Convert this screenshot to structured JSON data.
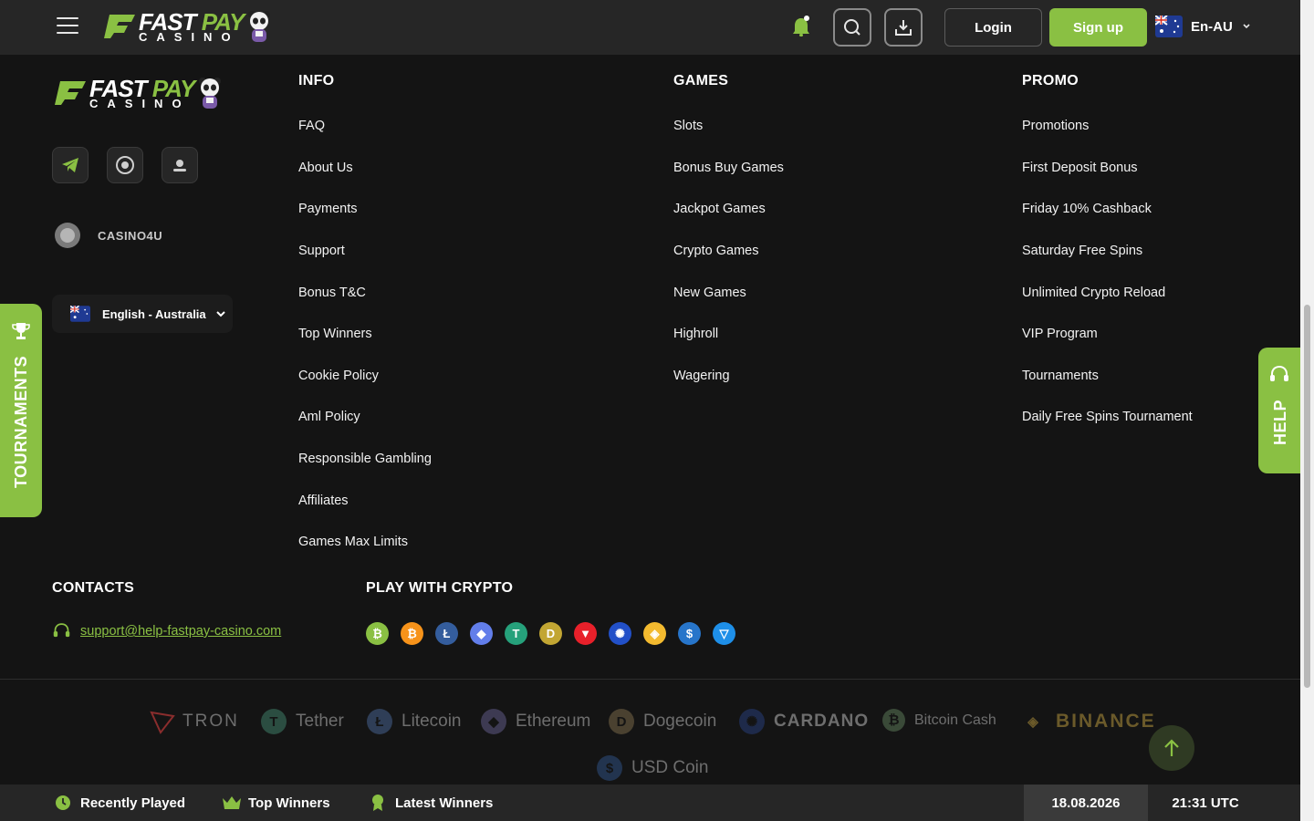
{
  "header": {
    "logo": {
      "fast": "FAST",
      "pay": "PAY",
      "casino": "CASINO"
    },
    "login_label": "Login",
    "signup_label": "Sign up",
    "language_code": "En-AU"
  },
  "footer_logo": {
    "fast": "FAST",
    "pay": "PAY",
    "casino": "CASINO"
  },
  "partner": {
    "label": "CASINO4U"
  },
  "language_select": {
    "label": "English - Australia"
  },
  "tabs": {
    "tournaments": "TOURNAMENTS",
    "help": "HELP"
  },
  "columns": {
    "info": {
      "title": "INFO",
      "links": [
        "FAQ",
        "About Us",
        "Payments",
        "Support",
        "Bonus T&C",
        "Top Winners",
        "Cookie Policy",
        "Aml Policy",
        "Responsible Gambling",
        "Affiliates",
        "Games Max Limits"
      ]
    },
    "games": {
      "title": "GAMES",
      "links": [
        "Slots",
        "Bonus Buy Games",
        "Jackpot Games",
        "Crypto Games",
        "New Games",
        "Highroll",
        "Wagering"
      ]
    },
    "promo": {
      "title": "PROMO",
      "links": [
        "Promotions",
        "First Deposit Bonus",
        "Friday 10% Cashback",
        "Saturday Free Spins",
        "Unlimited Crypto Reload",
        "VIP Program",
        "Tournaments",
        "Daily Free Spins Tournament"
      ]
    }
  },
  "contacts": {
    "title": "CONTACTS",
    "email": "support@help-fastpay-casino.com"
  },
  "crypto": {
    "title": "PLAY WITH CRYPTO",
    "coins": [
      {
        "name": "bitcoin-cash",
        "glyph": "₿",
        "color": "#8ac043"
      },
      {
        "name": "bitcoin",
        "glyph": "₿",
        "color": "#f7931a"
      },
      {
        "name": "litecoin",
        "glyph": "Ł",
        "color": "#345d9d"
      },
      {
        "name": "ethereum",
        "glyph": "◆",
        "color": "#627eea"
      },
      {
        "name": "tether",
        "glyph": "T",
        "color": "#26a17b"
      },
      {
        "name": "dogecoin",
        "glyph": "D",
        "color": "#c2a633"
      },
      {
        "name": "tron",
        "glyph": "▼",
        "color": "#e8202a"
      },
      {
        "name": "cardano",
        "glyph": "✺",
        "color": "#2250c8"
      },
      {
        "name": "binance",
        "glyph": "◈",
        "color": "#f3ba2f"
      },
      {
        "name": "usd-coin",
        "glyph": "$",
        "color": "#2775ca"
      },
      {
        "name": "toncoin",
        "glyph": "▽",
        "color": "#1e8fe8"
      }
    ]
  },
  "brands": [
    "TRON",
    "Tether",
    "Litecoin",
    "Ethereum",
    "Dogecoin",
    "CARDANO",
    "Bitcoin Cash",
    "BINANCE",
    "USD Coin"
  ],
  "bottom_bar": {
    "recently_played": "Recently Played",
    "top_winners": "Top Winners",
    "latest_winners": "Latest Winners",
    "date": "18.08.2026",
    "time": "21:31 UTC"
  },
  "colors": {
    "accent": "#8ac043",
    "background": "#141414",
    "header": "#262626"
  }
}
